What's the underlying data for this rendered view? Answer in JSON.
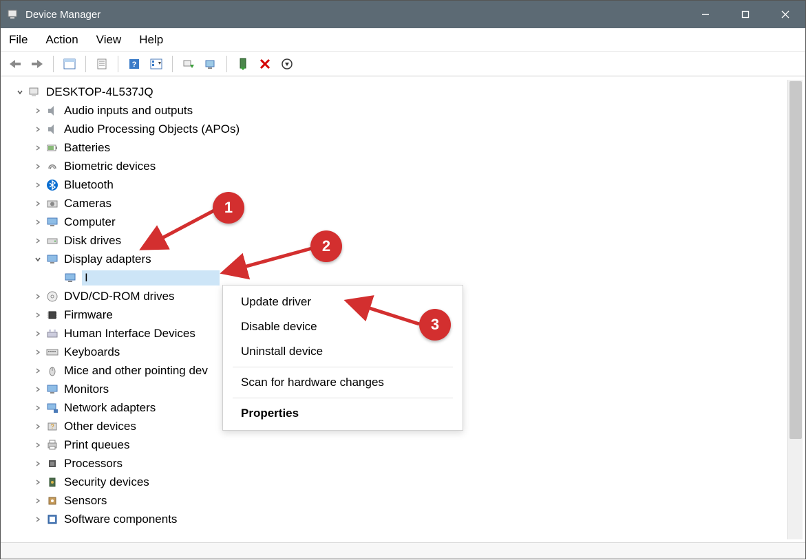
{
  "titlebar": {
    "title": "Device Manager"
  },
  "menubar": {
    "file": "File",
    "action": "Action",
    "view": "View",
    "help": "Help"
  },
  "tree": {
    "root": "DESKTOP-4L537JQ",
    "items": [
      {
        "label": "Audio inputs and outputs",
        "icon": "speaker"
      },
      {
        "label": "Audio Processing Objects (APOs)",
        "icon": "speaker"
      },
      {
        "label": "Batteries",
        "icon": "battery"
      },
      {
        "label": "Biometric devices",
        "icon": "fingerprint"
      },
      {
        "label": "Bluetooth",
        "icon": "bluetooth"
      },
      {
        "label": "Cameras",
        "icon": "camera"
      },
      {
        "label": "Computer",
        "icon": "monitor"
      },
      {
        "label": "Disk drives",
        "icon": "disk"
      },
      {
        "label": "Display adapters",
        "icon": "display",
        "expanded": true
      },
      {
        "label": "DVD/CD-ROM drives",
        "icon": "cd"
      },
      {
        "label": "Firmware",
        "icon": "chip"
      },
      {
        "label": "Human Interface Devices",
        "icon": "hid"
      },
      {
        "label": "Keyboards",
        "icon": "keyboard"
      },
      {
        "label": "Mice and other pointing devices",
        "icon": "mouse",
        "truncated": "Mice and other pointing dev"
      },
      {
        "label": "Monitors",
        "icon": "monitor"
      },
      {
        "label": "Network adapters",
        "icon": "network"
      },
      {
        "label": "Other devices",
        "icon": "other"
      },
      {
        "label": "Print queues",
        "icon": "printer"
      },
      {
        "label": "Processors",
        "icon": "cpu"
      },
      {
        "label": "Security devices",
        "icon": "security"
      },
      {
        "label": "Sensors",
        "icon": "sensor"
      },
      {
        "label": "Software components",
        "icon": "software"
      }
    ],
    "selected_child": {
      "label": "I"
    }
  },
  "context_menu": {
    "update": "Update driver",
    "disable": "Disable device",
    "uninstall": "Uninstall device",
    "scan": "Scan for hardware changes",
    "properties": "Properties"
  },
  "callouts": {
    "b1": "1",
    "b2": "2",
    "b3": "3"
  }
}
